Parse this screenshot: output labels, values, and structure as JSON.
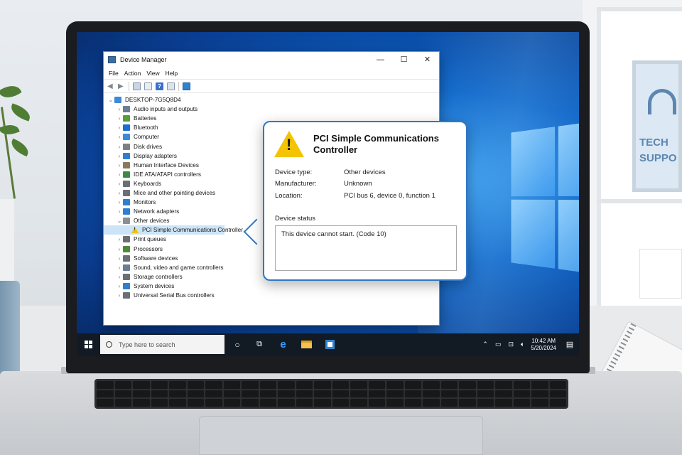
{
  "window": {
    "title": "Device Manager",
    "minimize": "—",
    "maximize": "☐",
    "close": "✕"
  },
  "menu": [
    "File",
    "Action",
    "View",
    "Help"
  ],
  "tree": {
    "root": "DESKTOP-7G5Q8D4",
    "categories": [
      {
        "label": "Audio inputs and outputs",
        "icon": "speaker-icon",
        "color": "#6b7f93"
      },
      {
        "label": "Batteries",
        "icon": "battery-icon",
        "color": "#5a9e3a"
      },
      {
        "label": "Bluetooth",
        "icon": "bluetooth-icon",
        "color": "#1a6fd1"
      },
      {
        "label": "Computer",
        "icon": "computer-icon",
        "color": "#3c8ad8"
      },
      {
        "label": "Disk drives",
        "icon": "disk-icon",
        "color": "#7b7f86"
      },
      {
        "label": "Display adapters",
        "icon": "display-adapter-icon",
        "color": "#2f7fd0"
      },
      {
        "label": "Human Interface Devices",
        "icon": "hid-icon",
        "color": "#8a7b5d"
      },
      {
        "label": "IDE ATA/ATAPI controllers",
        "icon": "ide-icon",
        "color": "#3e8a45"
      },
      {
        "label": "Keyboards",
        "icon": "keyboard-icon",
        "color": "#6b6f76"
      },
      {
        "label": "Mice and other pointing devices",
        "icon": "mouse-icon",
        "color": "#6b6f76"
      },
      {
        "label": "Monitors",
        "icon": "monitor-icon",
        "color": "#2f7fd0"
      },
      {
        "label": "Network adapters",
        "icon": "network-icon",
        "color": "#2f7fd0"
      },
      {
        "label": "Other devices",
        "icon": "other-devices-icon",
        "color": "#8a8f96",
        "expanded": true
      }
    ],
    "expanded_child": "PCI Simple Communications Controller",
    "categories_after": [
      {
        "label": "Print queues",
        "icon": "printer-icon",
        "color": "#6b6f76"
      },
      {
        "label": "Processors",
        "icon": "processor-icon",
        "color": "#4f8a3a"
      },
      {
        "label": "Software devices",
        "icon": "software-device-icon",
        "color": "#6b6f76"
      },
      {
        "label": "Sound, video and game controllers",
        "icon": "sound-icon",
        "color": "#6b7f93"
      },
      {
        "label": "Storage controllers",
        "icon": "storage-icon",
        "color": "#6b6f76"
      },
      {
        "label": "System devices",
        "icon": "system-devices-icon",
        "color": "#2f7fd0"
      },
      {
        "label": "Universal Serial Bus controllers",
        "icon": "usb-icon",
        "color": "#6b6f76"
      }
    ]
  },
  "callout": {
    "title": "PCI Simple Communications Controller",
    "properties": [
      {
        "key": "Device type:",
        "value": "Other devices"
      },
      {
        "key": "Manufacturer:",
        "value": "Unknown"
      },
      {
        "key": "Location:",
        "value": "PCI bus 6, device 0, function 1"
      }
    ],
    "status_label": "Device status",
    "status_text": "This device cannot start. (Code 10)"
  },
  "taskbar": {
    "search_placeholder": "Type here to search",
    "time": "10:42 AM",
    "date": "5/20/2024"
  },
  "poster": {
    "text": "TECH\nSUPPO"
  },
  "colors": {
    "accent": "#2f78c4",
    "warning": "#f4c400",
    "taskbar": "#121a24"
  }
}
